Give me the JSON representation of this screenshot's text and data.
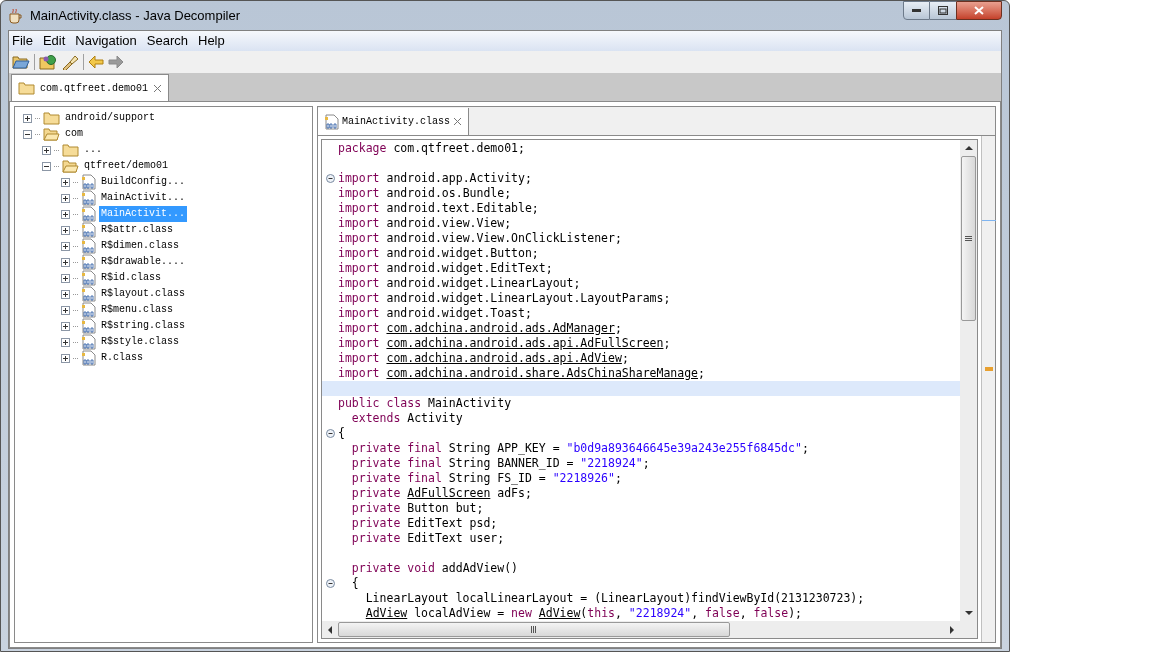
{
  "window": {
    "title": "MainActivity.class - Java Decompiler"
  },
  "menu": [
    "File",
    "Edit",
    "Navigation",
    "Search",
    "Help"
  ],
  "toolbar": [
    {
      "kind": "open"
    },
    {
      "kind": "open-type"
    },
    {
      "kind": "search"
    },
    {
      "kind": "back",
      "disabled": false
    },
    {
      "kind": "forward",
      "disabled": true
    }
  ],
  "archive_tab": {
    "label": "com.qtfreet.demo01",
    "selected": true
  },
  "tree": [
    {
      "label": "android/support",
      "kind": "folder",
      "expanded": false,
      "selected": false
    },
    {
      "label": "com",
      "kind": "folder",
      "expanded": true,
      "selected": false,
      "children": [
        {
          "label": "...",
          "kind": "folder",
          "expanded": false,
          "selected": false
        },
        {
          "label": "qtfreet/demo01",
          "kind": "folder",
          "expanded": true,
          "selected": false,
          "children": [
            {
              "label": "BuildConfig...",
              "kind": "class",
              "expanded": false,
              "selected": false
            },
            {
              "label": "MainActivit...",
              "kind": "class",
              "expanded": false,
              "selected": false
            },
            {
              "label": "MainActivit...",
              "kind": "class",
              "expanded": false,
              "selected": true
            },
            {
              "label": "R$attr.class",
              "kind": "class",
              "expanded": false,
              "selected": false
            },
            {
              "label": "R$dimen.class",
              "kind": "class",
              "expanded": false,
              "selected": false
            },
            {
              "label": "R$drawable....",
              "kind": "class",
              "expanded": false,
              "selected": false
            },
            {
              "label": "R$id.class",
              "kind": "class",
              "expanded": false,
              "selected": false
            },
            {
              "label": "R$layout.class",
              "kind": "class",
              "expanded": false,
              "selected": false
            },
            {
              "label": "R$menu.class",
              "kind": "class",
              "expanded": false,
              "selected": false
            },
            {
              "label": "R$string.class",
              "kind": "class",
              "expanded": false,
              "selected": false
            },
            {
              "label": "R$style.class",
              "kind": "class",
              "expanded": false,
              "selected": false
            },
            {
              "label": "R.class",
              "kind": "class",
              "expanded": false,
              "selected": false
            }
          ]
        }
      ]
    }
  ],
  "editor_tab": {
    "label": "MainActivity.class",
    "selected": true
  },
  "code": [
    {
      "fold": false,
      "highlighted": false,
      "tokens": [
        {
          "kind": "kw",
          "text": "package"
        },
        {
          "kind": "plain",
          "text": " com.qtfreet.demo01;"
        }
      ]
    },
    {
      "fold": false,
      "highlighted": false
    },
    {
      "fold": true,
      "highlighted": false,
      "tokens": [
        {
          "kind": "kw",
          "text": "import"
        },
        {
          "kind": "plain",
          "text": " android.app.Activity;"
        }
      ]
    },
    {
      "fold": false,
      "highlighted": false,
      "tokens": [
        {
          "kind": "kw",
          "text": "import"
        },
        {
          "kind": "plain",
          "text": " android.os.Bundle;"
        }
      ]
    },
    {
      "fold": false,
      "highlighted": false,
      "tokens": [
        {
          "kind": "kw",
          "text": "import"
        },
        {
          "kind": "plain",
          "text": " android.text.Editable;"
        }
      ]
    },
    {
      "fold": false,
      "highlighted": false,
      "tokens": [
        {
          "kind": "kw",
          "text": "import"
        },
        {
          "kind": "plain",
          "text": " android.view.View;"
        }
      ]
    },
    {
      "fold": false,
      "highlighted": false,
      "tokens": [
        {
          "kind": "kw",
          "text": "import"
        },
        {
          "kind": "plain",
          "text": " android.view.View.OnClickListener;"
        }
      ]
    },
    {
      "fold": false,
      "highlighted": false,
      "tokens": [
        {
          "kind": "kw",
          "text": "import"
        },
        {
          "kind": "plain",
          "text": " android.widget.Button;"
        }
      ]
    },
    {
      "fold": false,
      "highlighted": false,
      "tokens": [
        {
          "kind": "kw",
          "text": "import"
        },
        {
          "kind": "plain",
          "text": " android.widget.EditText;"
        }
      ]
    },
    {
      "fold": false,
      "highlighted": false,
      "tokens": [
        {
          "kind": "kw",
          "text": "import"
        },
        {
          "kind": "plain",
          "text": " android.widget.LinearLayout;"
        }
      ]
    },
    {
      "fold": false,
      "highlighted": false,
      "tokens": [
        {
          "kind": "kw",
          "text": "import"
        },
        {
          "kind": "plain",
          "text": " android.widget.LinearLayout.LayoutParams;"
        }
      ]
    },
    {
      "fold": false,
      "highlighted": false,
      "tokens": [
        {
          "kind": "kw",
          "text": "import"
        },
        {
          "kind": "plain",
          "text": " android.widget.Toast;"
        }
      ]
    },
    {
      "fold": false,
      "highlighted": false,
      "tokens": [
        {
          "kind": "kw",
          "text": "import "
        },
        {
          "kind": "link",
          "text": "com.adchina.android.ads.AdManager"
        },
        {
          "kind": "plain",
          "text": ";"
        }
      ]
    },
    {
      "fold": false,
      "highlighted": false,
      "tokens": [
        {
          "kind": "kw",
          "text": "import "
        },
        {
          "kind": "link",
          "text": "com.adchina.android.ads.api.AdFullScreen"
        },
        {
          "kind": "plain",
          "text": ";"
        }
      ]
    },
    {
      "fold": false,
      "highlighted": false,
      "tokens": [
        {
          "kind": "kw",
          "text": "import "
        },
        {
          "kind": "link",
          "text": "com.adchina.android.ads.api.AdView"
        },
        {
          "kind": "plain",
          "text": ";"
        }
      ]
    },
    {
      "fold": false,
      "highlighted": false,
      "tokens": [
        {
          "kind": "kw",
          "text": "import "
        },
        {
          "kind": "link",
          "text": "com.adchina.android.share.AdsChinaShareManage"
        },
        {
          "kind": "plain",
          "text": ";"
        }
      ]
    },
    {
      "fold": false,
      "highlighted": true
    },
    {
      "fold": false,
      "highlighted": false,
      "tokens": [
        {
          "kind": "kw",
          "text": "public class"
        },
        {
          "kind": "plain",
          "text": " MainActivity"
        }
      ]
    },
    {
      "fold": false,
      "highlighted": false,
      "tokens": [
        {
          "kind": "kw",
          "text": "  extends"
        },
        {
          "kind": "plain",
          "text": " Activity"
        }
      ]
    },
    {
      "fold": true,
      "highlighted": false,
      "tokens": [
        {
          "kind": "plain",
          "text": "{"
        }
      ]
    },
    {
      "fold": false,
      "highlighted": false,
      "tokens": [
        {
          "kind": "kw",
          "text": "  private final"
        },
        {
          "kind": "plain",
          "text": " String APP_KEY = "
        },
        {
          "kind": "str",
          "text": "\"b0d9a893646645e39a243e255f6845dc\""
        },
        {
          "kind": "plain",
          "text": ";"
        }
      ]
    },
    {
      "fold": false,
      "highlighted": false,
      "tokens": [
        {
          "kind": "kw",
          "text": "  private final"
        },
        {
          "kind": "plain",
          "text": " String BANNER_ID = "
        },
        {
          "kind": "str",
          "text": "\"2218924\""
        },
        {
          "kind": "plain",
          "text": ";"
        }
      ]
    },
    {
      "fold": false,
      "highlighted": false,
      "tokens": [
        {
          "kind": "kw",
          "text": "  private final"
        },
        {
          "kind": "plain",
          "text": " String FS_ID = "
        },
        {
          "kind": "str",
          "text": "\"2218926\""
        },
        {
          "kind": "plain",
          "text": ";"
        }
      ]
    },
    {
      "fold": false,
      "highlighted": false,
      "tokens": [
        {
          "kind": "kw",
          "text": "  private "
        },
        {
          "kind": "link",
          "text": "AdFullScreen"
        },
        {
          "kind": "plain",
          "text": " adFs;"
        }
      ]
    },
    {
      "fold": false,
      "highlighted": false,
      "tokens": [
        {
          "kind": "kw",
          "text": "  private"
        },
        {
          "kind": "plain",
          "text": " Button but;"
        }
      ]
    },
    {
      "fold": false,
      "highlighted": false,
      "tokens": [
        {
          "kind": "kw",
          "text": "  private"
        },
        {
          "kind": "plain",
          "text": " EditText psd;"
        }
      ]
    },
    {
      "fold": false,
      "highlighted": false,
      "tokens": [
        {
          "kind": "kw",
          "text": "  private"
        },
        {
          "kind": "plain",
          "text": " EditText user;"
        }
      ]
    },
    {
      "fold": false,
      "highlighted": false
    },
    {
      "fold": false,
      "highlighted": false,
      "tokens": [
        {
          "kind": "kw",
          "text": "  private void"
        },
        {
          "kind": "plain",
          "text": " addAdView()"
        }
      ]
    },
    {
      "fold": true,
      "highlighted": false,
      "tokens": [
        {
          "kind": "plain",
          "text": "  {"
        }
      ]
    },
    {
      "fold": false,
      "highlighted": false,
      "tokens": [
        {
          "kind": "plain",
          "text": "    LinearLayout localLinearLayout = (LinearLayout)findViewById(2131230723);"
        }
      ]
    },
    {
      "fold": false,
      "highlighted": false,
      "tokens": [
        {
          "kind": "link",
          "text": "    AdView"
        },
        {
          "kind": "plain",
          "text": " localAdView = "
        },
        {
          "kind": "kw",
          "text": "new "
        },
        {
          "kind": "link",
          "text": "AdView"
        },
        {
          "kind": "plain",
          "text": "("
        },
        {
          "kind": "kw",
          "text": "this"
        },
        {
          "kind": "plain",
          "text": ", "
        },
        {
          "kind": "str",
          "text": "\"2218924\""
        },
        {
          "kind": "plain",
          "text": ", "
        },
        {
          "kind": "kw",
          "text": "false"
        },
        {
          "kind": "plain",
          "text": ", "
        },
        {
          "kind": "kw",
          "text": "false"
        },
        {
          "kind": "plain",
          "text": ");"
        }
      ]
    }
  ]
}
